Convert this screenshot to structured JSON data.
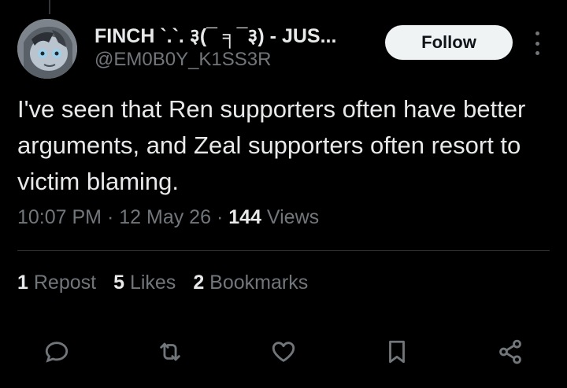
{
  "author": {
    "display_name": "FINCH `.`. ३(¯ ╕¯३) - JUS...",
    "handle": "@EM0B0Y_K1SS3R"
  },
  "follow_label": "Follow",
  "tweet": {
    "text": "I've seen that Ren supporters often have better arguments, and Zeal supporters often resort to victim blaming."
  },
  "meta": {
    "time": "10:07 PM",
    "date": "12 May 26",
    "views_count": "144",
    "views_label": "Views",
    "separator": "·"
  },
  "stats": {
    "reposts_count": "1",
    "reposts_label": "Repost",
    "likes_count": "5",
    "likes_label": "Likes",
    "bookmarks_count": "2",
    "bookmarks_label": "Bookmarks"
  },
  "actions": [
    "reply-icon",
    "repost-icon",
    "like-icon",
    "bookmark-icon",
    "share-icon"
  ],
  "colors": {
    "background": "#000000",
    "primary_text": "#e7e9ea",
    "secondary_text": "#71767b",
    "follow_button_bg": "#eff3f4",
    "divider": "#2f3336"
  }
}
